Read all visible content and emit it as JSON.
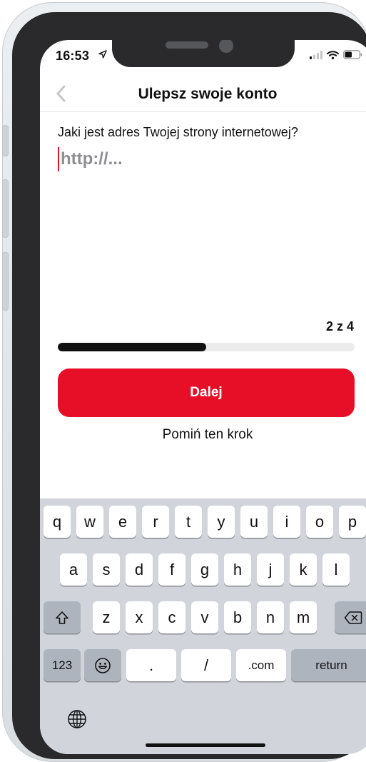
{
  "status_bar": {
    "time": "16:53",
    "icons": [
      "location-arrow-icon",
      "signal-icon",
      "wifi-icon",
      "battery-icon"
    ]
  },
  "nav": {
    "title": "Ulepsz swoje konto",
    "back_icon": "chevron-left-icon"
  },
  "form": {
    "question": "Jaki jest adres Twojej strony internetowej?",
    "url_value": "",
    "url_placeholder": "http://..."
  },
  "progress": {
    "label": "2 z 4",
    "current_step": 2,
    "total_steps": 4,
    "fraction": 0.5
  },
  "actions": {
    "next_label": "Dalej",
    "skip_label": "Pomiń ten krok"
  },
  "keyboard": {
    "row1": [
      "q",
      "w",
      "e",
      "r",
      "t",
      "y",
      "u",
      "i",
      "o",
      "p"
    ],
    "row2": [
      "a",
      "s",
      "d",
      "f",
      "g",
      "h",
      "j",
      "k",
      "l"
    ],
    "row3": [
      "z",
      "x",
      "c",
      "v",
      "b",
      "n",
      "m"
    ],
    "row4": {
      "numbers": "123",
      "dot": ".",
      "slash": "/",
      "dotcom": ".com",
      "return": "return"
    },
    "icons": [
      "shift-icon",
      "backspace-icon",
      "emoji-icon",
      "globe-icon"
    ]
  },
  "colors": {
    "accent": "#e60f27",
    "progress_fill": "#111111",
    "progress_track": "#ececec",
    "keyboard_bg": "#d1d4da"
  }
}
